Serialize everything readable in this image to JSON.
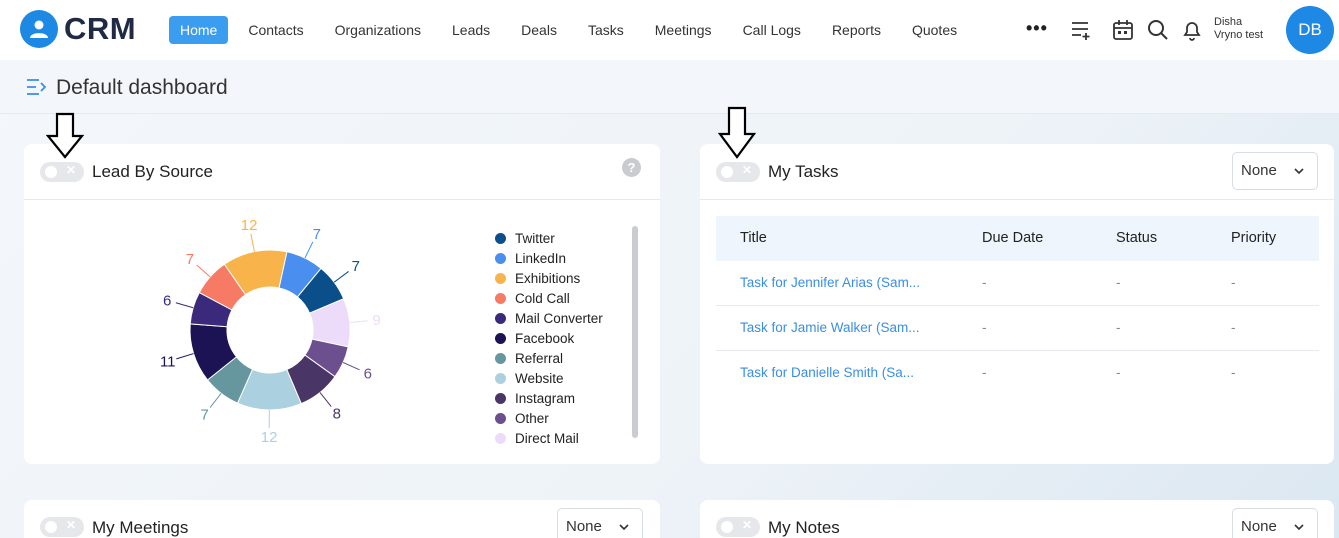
{
  "app": {
    "brand": "CRM"
  },
  "nav": {
    "items": [
      "Home",
      "Contacts",
      "Organizations",
      "Leads",
      "Deals",
      "Tasks",
      "Meetings",
      "Call Logs",
      "Reports",
      "Quotes"
    ],
    "active": "Home",
    "more": "•••",
    "icons": [
      "add-list-icon",
      "calendar-icon",
      "search-icon",
      "bell-icon"
    ]
  },
  "user": {
    "first": "Disha",
    "second": "Vryno test",
    "initials": "DB"
  },
  "page": {
    "title": "Default dashboard"
  },
  "lead_by_source": {
    "title": "Lead By Source",
    "help": "?",
    "chart_data": {
      "type": "pie",
      "categories": [
        "Twitter",
        "LinkedIn",
        "Exhibitions",
        "Cold Call",
        "Mail Converter",
        "Facebook",
        "Referral",
        "Website",
        "Instagram",
        "Other",
        "Direct Mail"
      ],
      "values": [
        7,
        7,
        12,
        7,
        6,
        11,
        7,
        12,
        8,
        6,
        9
      ],
      "colors": [
        "#0b4f8a",
        "#4a8ff0",
        "#f9b34b",
        "#f77b64",
        "#3b2a7c",
        "#1c1354",
        "#66979f",
        "#abd0df",
        "#4a3567",
        "#6b4f8f",
        "#ecdcf9"
      ],
      "chart_order": [
        "Twitter",
        "Direct Mail",
        "Other",
        "Instagram",
        "Website",
        "Referral",
        "Facebook",
        "Mail Converter",
        "Cold Call",
        "Exhibitions",
        "LinkedIn"
      ]
    },
    "legend_colors": [
      "#0b4f8a",
      "#4a8ff0",
      "#f9b34b",
      "#f77b64",
      "#3b2a7c",
      "#1c1354",
      "#66979f",
      "#abd0df",
      "#4a3567",
      "#6b4f8f",
      "#ecdcf9"
    ]
  },
  "my_tasks": {
    "title": "My Tasks",
    "filter": "None",
    "columns": [
      "Title",
      "Due Date",
      "Status",
      "Priority"
    ],
    "rows": [
      [
        "Task for Jennifer Arias (Sam...",
        "-",
        "-",
        "-"
      ],
      [
        "Task for Jamie Walker (Sam...",
        "-",
        "-",
        "-"
      ],
      [
        "Task for Danielle Smith (Sa...",
        "-",
        "-",
        "-"
      ]
    ]
  },
  "my_meetings": {
    "title": "My Meetings",
    "filter": "None"
  },
  "my_notes": {
    "title": "My Notes",
    "filter": "None"
  }
}
